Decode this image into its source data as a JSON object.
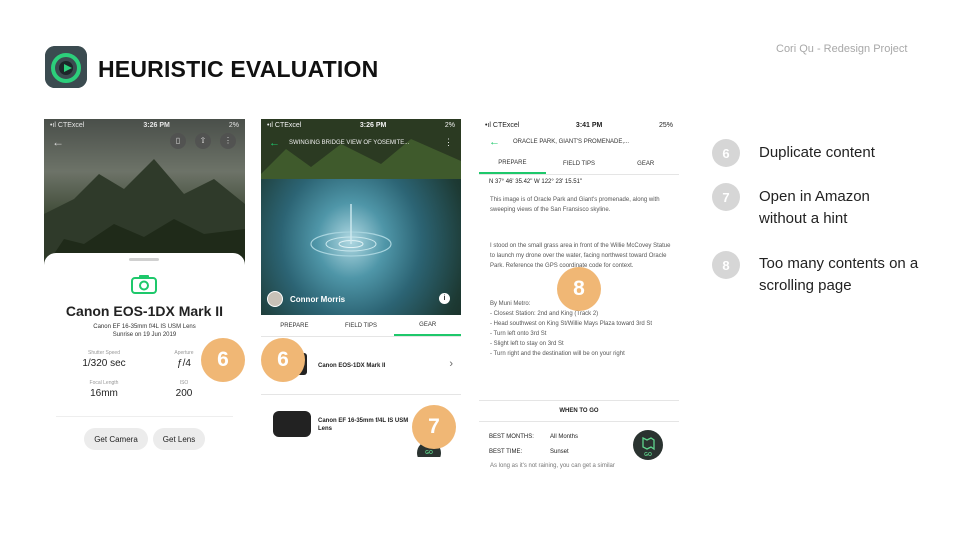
{
  "header": {
    "title": "HEURISTIC EVALUATION",
    "credit": "Cori Qu - Redesign Project"
  },
  "phone1": {
    "status": {
      "carrier": "•ıl CTExcel",
      "time": "3:26 PM",
      "battery": "2%"
    },
    "camera_name": "Canon EOS-1DX Mark II",
    "lens": "Canon EF 16-35mm f/4L IS USM Lens",
    "date": "Sunrise on 19 Jun 2019",
    "specs": [
      {
        "label": "Shutter Speed",
        "value": "1/320 sec"
      },
      {
        "label": "Aperture",
        "value": "ƒ/4"
      },
      {
        "label": "Focal Length",
        "value": "16mm"
      },
      {
        "label": "ISO",
        "value": "200"
      }
    ],
    "buttons": {
      "get_camera": "Get Camera",
      "get_lens": "Get Lens"
    },
    "marker": "6"
  },
  "phone2": {
    "status": {
      "carrier": "•ıl CTExcel",
      "time": "3:26 PM",
      "battery": "2%"
    },
    "location": "SWINGING BRIDGE VIEW OF YOSEMITE...",
    "author": "Connor Morris",
    "tabs": [
      "PREPARE",
      "FIELD TIPS",
      "GEAR"
    ],
    "gear": [
      {
        "name": "Canon EOS-1DX Mark II"
      },
      {
        "name": "Canon EF 16-35mm f/4L IS USM Lens"
      }
    ],
    "go_label": "GO",
    "markers": [
      "6",
      "7"
    ]
  },
  "phone3": {
    "status": {
      "carrier": "•ıl CTExcel",
      "time": "3:41 PM",
      "battery": "25%"
    },
    "location": "ORACLE PARK, GIANT'S PROMENADE,...",
    "tabs": [
      "PREPARE",
      "FIELD TIPS",
      "GEAR"
    ],
    "coords": "N 37° 46' 35.42\" W 122° 23' 15.51\"",
    "para1": "This image is of Oracle Park and Giant's promenade, along with sweeping views of the San Fransisco skyline.",
    "para2": "I stood on the small grass area in front of the Willie McCovey Statue to launch my drone over the water, facing northwest toward Oracle Park. Reference the GPS coordinate code for context.",
    "directions": [
      "By Muni Metro:",
      "- Closest Station: 2nd and King (Track 2)",
      "- Head southwest on King St/Willie Mays Plaza toward 3rd St",
      "- Turn left onto 3rd St",
      "- Slight left to stay on 3rd St",
      "- Turn right and the destination will be on your right"
    ],
    "when_to_go": "WHEN TO GO",
    "best_months_label": "BEST MONTHS:",
    "best_months": "All Months",
    "best_time_label": "BEST TIME:",
    "best_time": "Sunset",
    "footer_text": "As long as it's not raining, you can get a similar",
    "go_label": "GO",
    "marker": "8"
  },
  "legend": [
    {
      "num": "6",
      "text": "Duplicate content"
    },
    {
      "num": "7",
      "text": "Open in Amazon without a hint"
    },
    {
      "num": "8",
      "text": "Too many contents on a scrolling page"
    }
  ],
  "colors": {
    "accent": "#1ec86b",
    "marker": "#f0b775",
    "legend_badge": "#d6d6d6"
  }
}
